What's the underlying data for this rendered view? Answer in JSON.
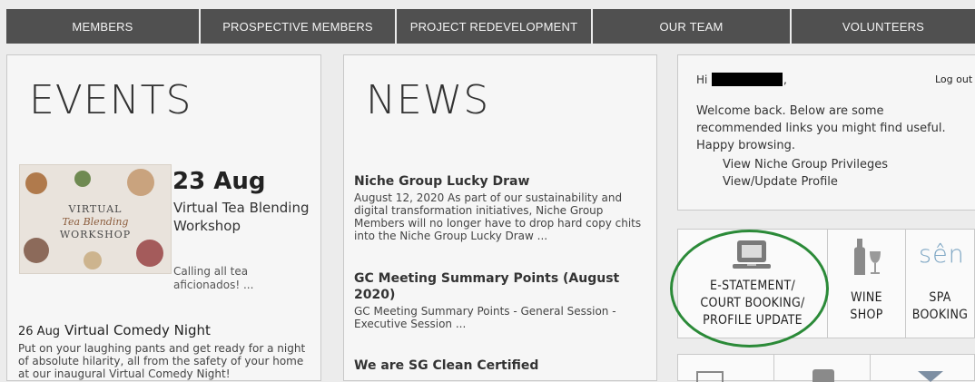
{
  "nav": {
    "items": [
      "MEMBERS",
      "PROSPECTIVE MEMBERS",
      "PROJECT REDEVELOPMENT",
      "OUR TEAM",
      "VOLUNTEERS"
    ]
  },
  "events": {
    "title": "EVENTS",
    "featured": {
      "image_caption": [
        "VIRTUAL",
        "Tea Blending",
        "WORKSHOP"
      ],
      "date": "23 Aug",
      "title": "Virtual Tea Blending Workshop",
      "desc": "Calling all tea aficionados!  ..."
    },
    "second": {
      "date": "26 Aug",
      "title": "Virtual Comedy Night",
      "desc": "Put on your laughing pants and get ready for a night of absolute hilarity, all from the safety of your home at our inaugural Virtual Comedy Night!"
    }
  },
  "news": {
    "title": "NEWS",
    "items": [
      {
        "title": "Niche Group Lucky Draw",
        "body": "August 12, 2020   As part of our sustainability and digital transformation initiatives, Niche Group Members will no longer have to drop hard copy chits into the Niche Group Lucky Draw ..."
      },
      {
        "title": "GC Meeting Summary Points (August 2020)",
        "body": "GC Meeting Summary Points   - General Session - Executive Session        ..."
      },
      {
        "title": "We are SG Clean Certified",
        "body": ""
      }
    ]
  },
  "account": {
    "greeting": "Hi",
    "comma": ",",
    "logout": "Log out",
    "welcome": "Welcome back. Below are some recommended links you might find useful. Happy browsing.",
    "links": [
      "View Niche Group Privileges",
      "View/Update Profile"
    ]
  },
  "tiles": [
    {
      "lines": [
        "E-STATEMENT/",
        "COURT BOOKING/",
        "PROFILE UPDATE"
      ],
      "icon": "laptop-icon"
    },
    {
      "lines": [
        "WINE",
        "SHOP"
      ],
      "icon": "wine-bottle-glass-icon"
    },
    {
      "lines": [
        "SPA",
        "BOOKING"
      ],
      "icon": "spa-logo-icon",
      "logo_text": "sên"
    }
  ],
  "colors": {
    "nav_bg": "#505050",
    "highlight_circle": "#2b8a38"
  }
}
